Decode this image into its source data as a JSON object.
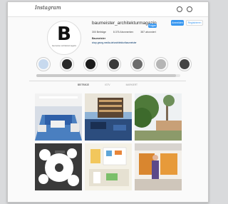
{
  "topbar": {
    "logo": "Instagram"
  },
  "profile": {
    "avatar_letter": "B",
    "avatar_caption": "baumeister architekturmagazin",
    "username": "baumeister_architekturmagazin",
    "follow_label": "Folgen",
    "top_follow_label": "Anmelden",
    "signup_label": "Registrieren",
    "stats": {
      "posts": "300 Beiträge",
      "followers": "8.376 Abonnenten",
      "following": "387 abonniert"
    },
    "bio_name": "Baumeister",
    "bio_text": "shop.georg-media.de/architektur/baumeister"
  },
  "highlights": [
    "#c7d9ee",
    "#2a2a2a",
    "#1c1c1c",
    "#3a3a3a",
    "#6b6b6b",
    "#b5b5b5",
    "#444444"
  ],
  "tabs": [
    "BEITRÄGE",
    "IGTV",
    "MARKIERT"
  ],
  "posts": [
    "blue interior",
    "bookshelf room",
    "trees and building",
    "infographic circles",
    "bright shop interior",
    "orange gallery"
  ]
}
